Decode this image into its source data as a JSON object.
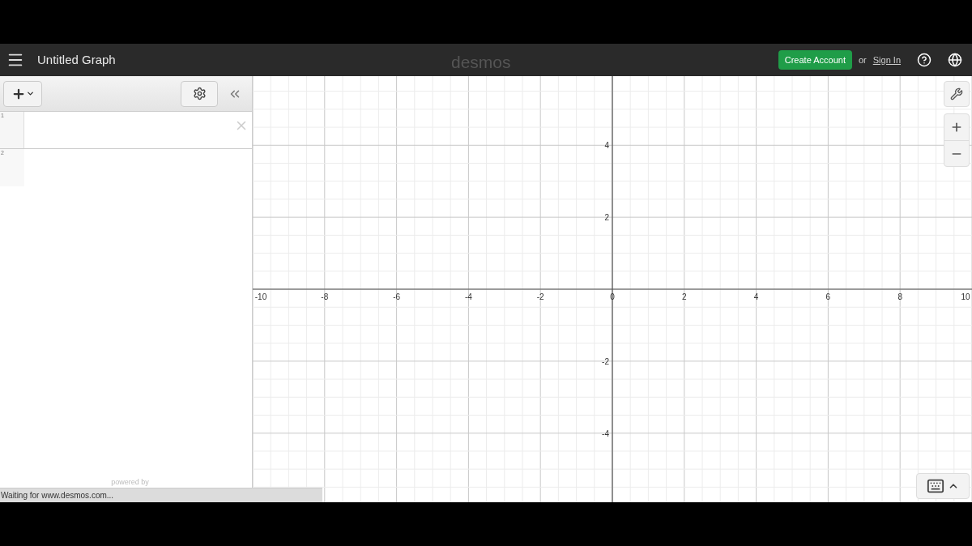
{
  "header": {
    "title": "Untitled Graph",
    "logo": "desmos",
    "create_account": "Create Account",
    "or": "or",
    "sign_in": "Sign In"
  },
  "expressions": [
    {
      "number": "1",
      "kind": "expression"
    },
    {
      "number": "2",
      "kind": "new"
    }
  ],
  "panel_footer": "powered by",
  "graph": {
    "chart_data": {
      "type": "line",
      "grid": true,
      "xlim": [
        -10,
        10
      ],
      "ylim": [
        -5.92,
        5.92
      ],
      "xticks": [
        -10,
        -8,
        -6,
        -4,
        -2,
        0,
        2,
        4,
        6,
        8,
        10
      ],
      "yticks": [
        -4,
        -2,
        2,
        4
      ]
    }
  },
  "status_bar": "Waiting for www.desmos.com..."
}
